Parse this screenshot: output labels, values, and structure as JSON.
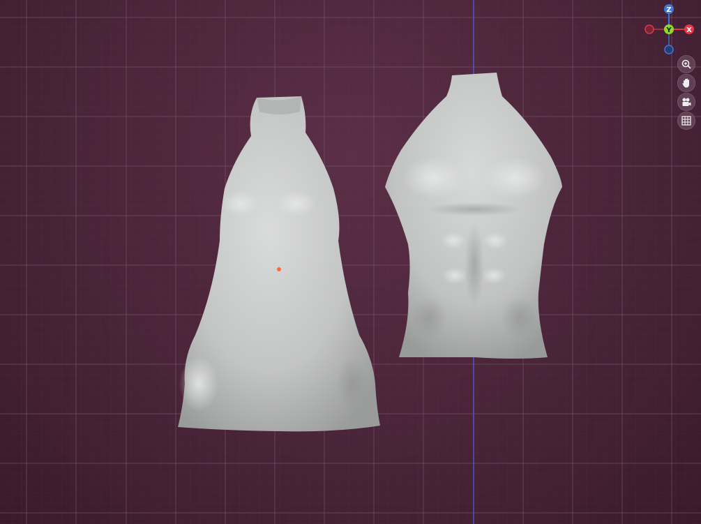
{
  "viewport": {
    "background": "#4a2439",
    "grid_color": "#7a5a6e",
    "axis_line_color": "#4b5cff"
  },
  "gizmo": {
    "z_label": "Z",
    "y_label": "Y",
    "x_label": "X",
    "z_color": "#3a78e0",
    "y_color": "#8fd62a",
    "x_color": "#e2384a"
  },
  "toolbar": {
    "items": [
      {
        "name": "zoom",
        "icon": "zoom-in-icon"
      },
      {
        "name": "pan",
        "icon": "hand-icon"
      },
      {
        "name": "camera",
        "icon": "camera-icon"
      },
      {
        "name": "grid",
        "icon": "grid-icon"
      }
    ]
  },
  "scene": {
    "objects": [
      {
        "name": "female-torso-dress-mesh",
        "color": "#c8c9c9"
      },
      {
        "name": "male-torso-mesh",
        "color": "#c8c9c9"
      }
    ],
    "origin_marker_color": "#ff6a3c"
  }
}
